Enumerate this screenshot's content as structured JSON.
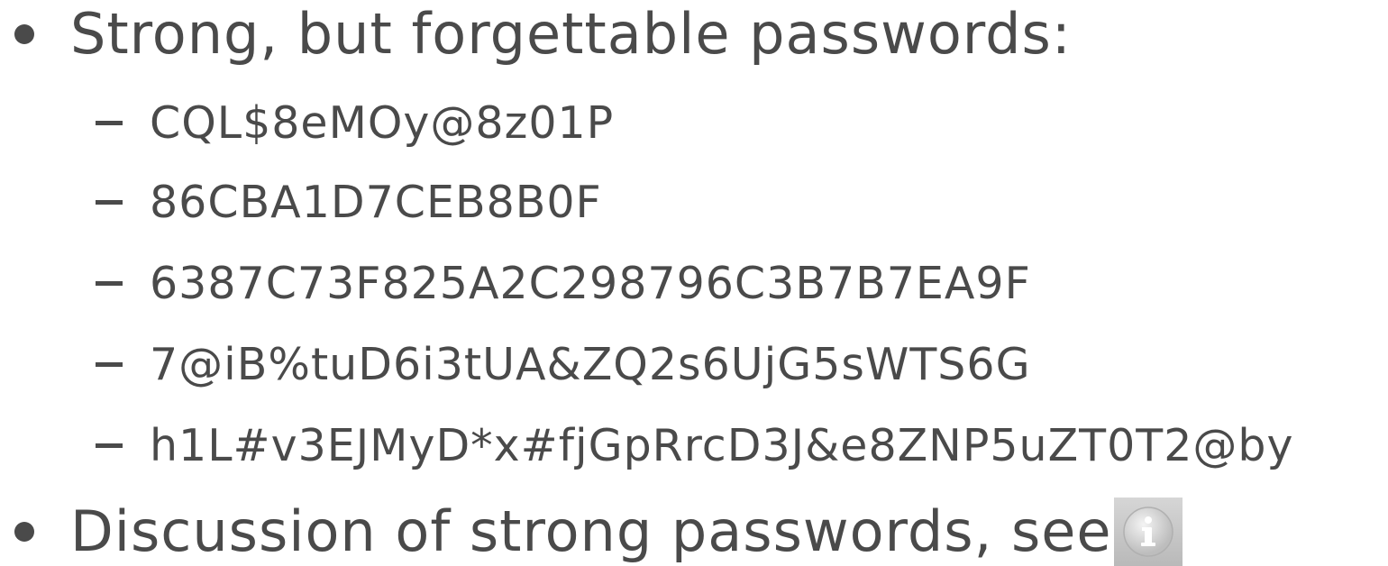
{
  "bullets": [
    {
      "text": "Strong, but forgettable passwords:",
      "subitems": [
        "CQL$8eMOy@8z01P",
        "86CBA1D7CEB8B0F",
        "6387C73F825A2C298796C3B7B7EA9F",
        "7@iB%tuD6i3tUA&ZQ2s6UjG5sWTS6G",
        "h1L#v3EJMyD*x#fjGpRrcD3J&e8ZNP5uZT0T2@by"
      ]
    },
    {
      "text": "Discussion of strong passwords, see",
      "icon": "info-icon"
    }
  ],
  "colors": {
    "text": "#4a4a4a",
    "background": "#ffffff",
    "icon_bg": "#c8c8c8"
  }
}
